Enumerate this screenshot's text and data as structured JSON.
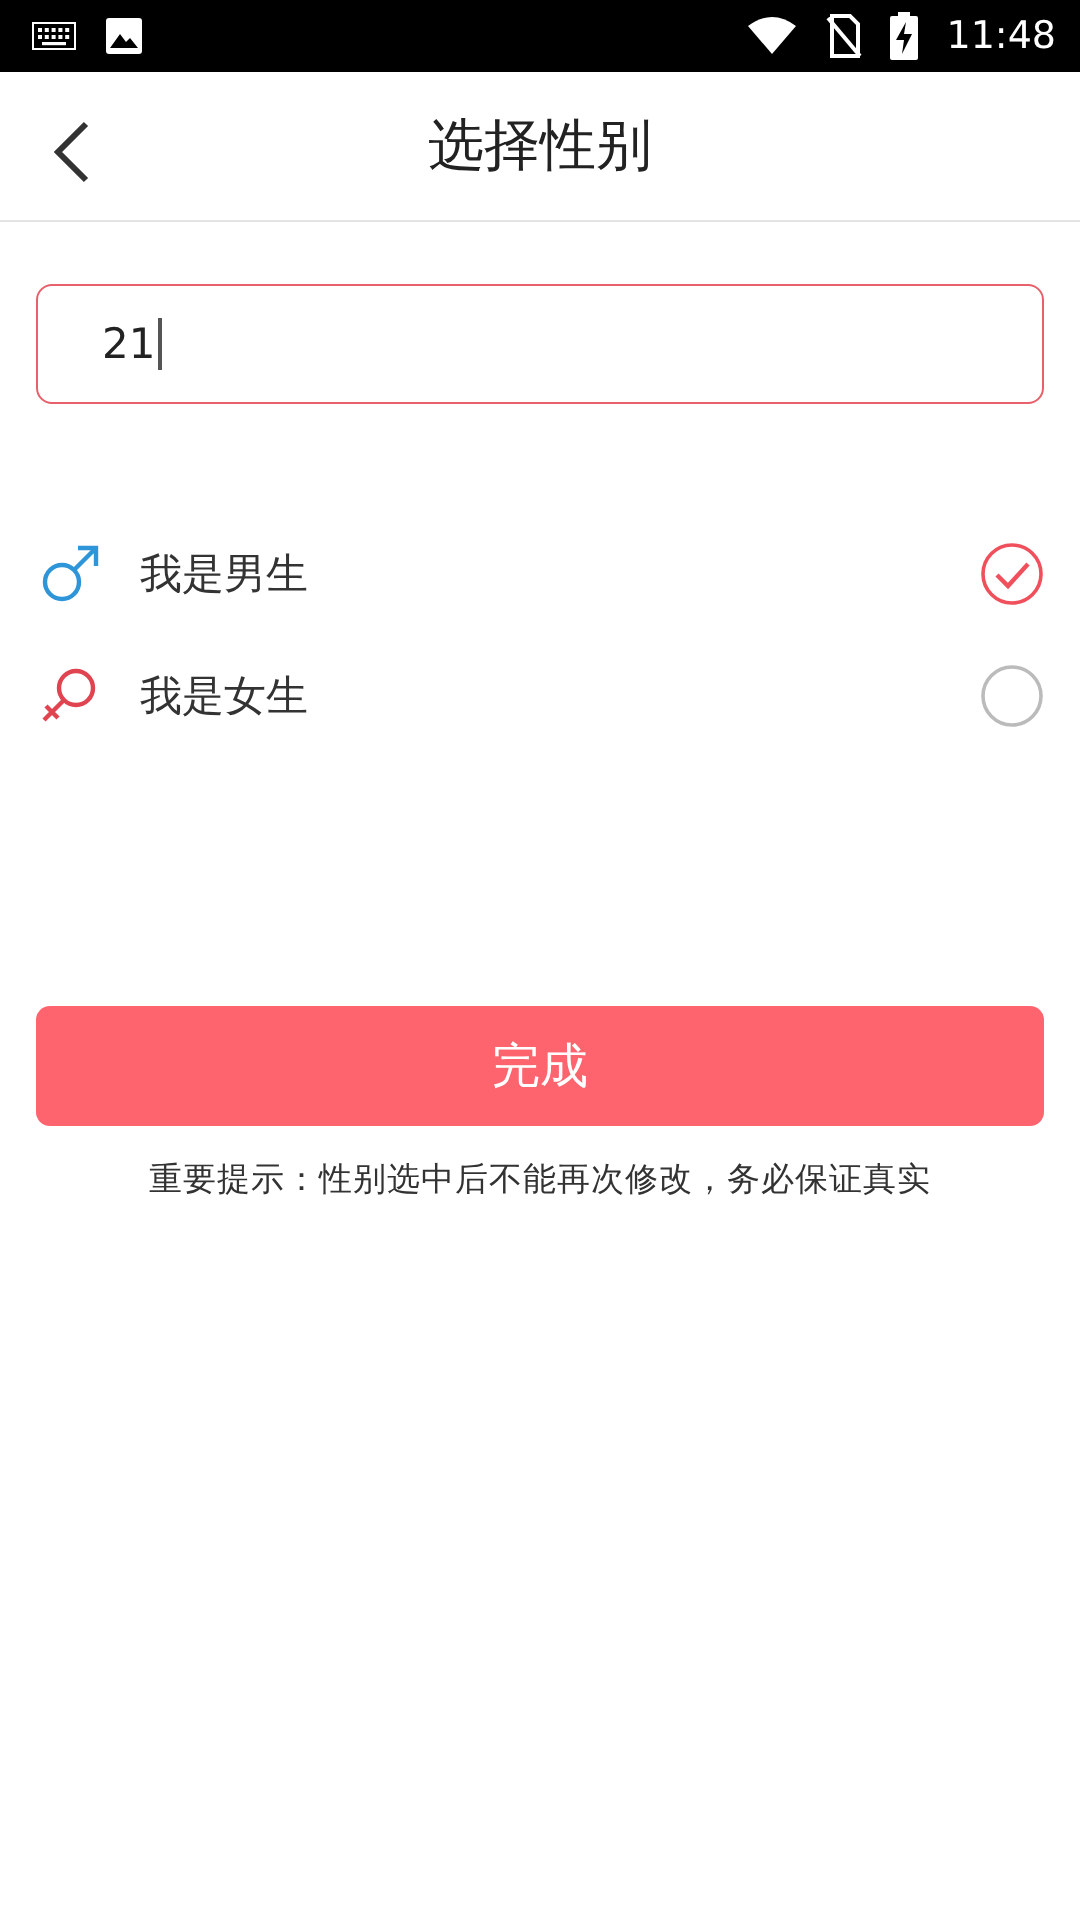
{
  "status_bar": {
    "time": "11:48"
  },
  "header": {
    "title": "选择性别"
  },
  "input": {
    "value": "21"
  },
  "options": [
    {
      "kind": "male",
      "label": "我是男生",
      "selected": true
    },
    {
      "kind": "female",
      "label": "我是女生",
      "selected": false
    }
  ],
  "submit": {
    "label": "完成"
  },
  "hint": "重要提示：性别选中后不能再次修改，务必保证真实"
}
